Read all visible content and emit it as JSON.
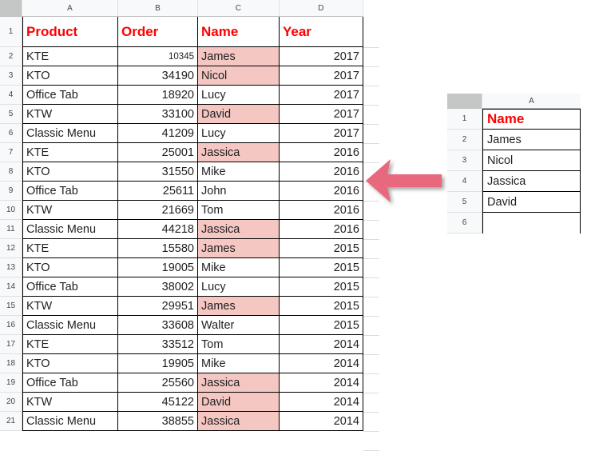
{
  "main_sheet": {
    "columns": [
      "A",
      "B",
      "C",
      "D"
    ],
    "headers": [
      "Product",
      "Order",
      "Name",
      "Year"
    ],
    "header_color": "#ff0000",
    "highlight_color": "#f4c7c3",
    "rows": [
      {
        "num": "2",
        "product": "KTE",
        "order": "10345",
        "name": "James",
        "year": "2017",
        "highlight": true,
        "small_order": true
      },
      {
        "num": "3",
        "product": "KTO",
        "order": "34190",
        "name": "Nicol",
        "year": "2017",
        "highlight": true,
        "small_order": false
      },
      {
        "num": "4",
        "product": "Office Tab",
        "order": "18920",
        "name": "Lucy",
        "year": "2017",
        "highlight": false,
        "small_order": false
      },
      {
        "num": "5",
        "product": "KTW",
        "order": "33100",
        "name": "David",
        "year": "2017",
        "highlight": true,
        "small_order": false
      },
      {
        "num": "6",
        "product": "Classic Menu",
        "order": "41209",
        "name": "Lucy",
        "year": "2017",
        "highlight": false,
        "small_order": false
      },
      {
        "num": "7",
        "product": "KTE",
        "order": "25001",
        "name": "Jassica",
        "year": "2016",
        "highlight": true,
        "small_order": false
      },
      {
        "num": "8",
        "product": "KTO",
        "order": "31550",
        "name": "Mike",
        "year": "2016",
        "highlight": false,
        "small_order": false
      },
      {
        "num": "9",
        "product": "Office Tab",
        "order": "25611",
        "name": "John",
        "year": "2016",
        "highlight": false,
        "small_order": false
      },
      {
        "num": "10",
        "product": "KTW",
        "order": "21669",
        "name": "Tom",
        "year": "2016",
        "highlight": false,
        "small_order": false
      },
      {
        "num": "11",
        "product": "Classic Menu",
        "order": "44218",
        "name": "Jassica",
        "year": "2016",
        "highlight": true,
        "small_order": false
      },
      {
        "num": "12",
        "product": "KTE",
        "order": "15580",
        "name": "James",
        "year": "2015",
        "highlight": true,
        "small_order": false
      },
      {
        "num": "13",
        "product": "KTO",
        "order": "19005",
        "name": "Mike",
        "year": "2015",
        "highlight": false,
        "small_order": false
      },
      {
        "num": "14",
        "product": "Office Tab",
        "order": "38002",
        "name": "Lucy",
        "year": "2015",
        "highlight": false,
        "small_order": false
      },
      {
        "num": "15",
        "product": "KTW",
        "order": "29951",
        "name": "James",
        "year": "2015",
        "highlight": true,
        "small_order": false
      },
      {
        "num": "16",
        "product": "Classic Menu",
        "order": "33608",
        "name": "Walter",
        "year": "2015",
        "highlight": false,
        "small_order": false
      },
      {
        "num": "17",
        "product": "KTE",
        "order": "33512",
        "name": "Tom",
        "year": "2014",
        "highlight": false,
        "small_order": false
      },
      {
        "num": "18",
        "product": "KTO",
        "order": "19905",
        "name": "Mike",
        "year": "2014",
        "highlight": false,
        "small_order": false
      },
      {
        "num": "19",
        "product": "Office Tab",
        "order": "25560",
        "name": "Jassica",
        "year": "2014",
        "highlight": true,
        "small_order": false
      },
      {
        "num": "20",
        "product": "KTW",
        "order": "45122",
        "name": "David",
        "year": "2014",
        "highlight": true,
        "small_order": false
      },
      {
        "num": "21",
        "product": "Classic Menu",
        "order": "38855",
        "name": "Jassica",
        "year": "2014",
        "highlight": true,
        "small_order": false
      }
    ],
    "header_row_num": "1"
  },
  "side_sheet": {
    "column": "A",
    "header": "Name",
    "header_row_num": "1",
    "rows": [
      {
        "num": "2",
        "name": "James"
      },
      {
        "num": "3",
        "name": "Nicol"
      },
      {
        "num": "4",
        "name": "Jassica"
      },
      {
        "num": "5",
        "name": "David"
      },
      {
        "num": "6",
        "name": ""
      }
    ]
  },
  "arrow": {
    "direction": "left",
    "color": "#e8697d",
    "label": "left-arrow"
  }
}
